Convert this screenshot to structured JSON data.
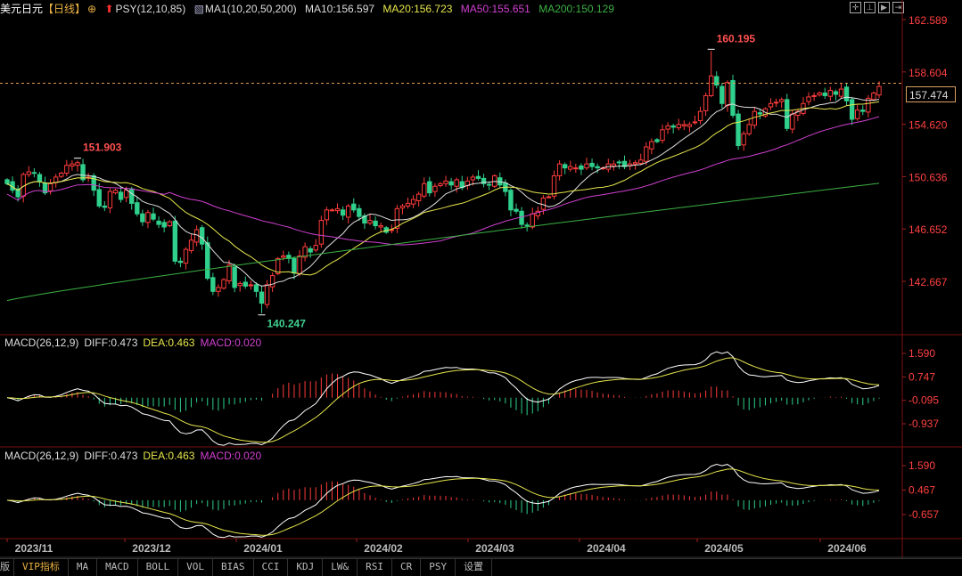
{
  "header": {
    "symbol": "美元日元",
    "period": "【日线】",
    "psy": "PSY(12,10,85)",
    "ma_name": "MA1(10,20,50,200)",
    "ma10": "MA10:156.597",
    "ma20": "MA20:156.723",
    "ma50": "MA50:155.651",
    "ma200": "MA200:150.129"
  },
  "toolbar": {
    "icons": [
      "crosshair-icon",
      "zoom-in-icon",
      "play-icon",
      "move-right-icon"
    ]
  },
  "colors": {
    "up": "#ff3b3b",
    "down": "#2fd08c",
    "ma10": "#e0e0e0",
    "ma20": "#e6e64c",
    "ma50": "#d040d0",
    "ma200": "#3cb043",
    "diff": "#ffffff",
    "dea": "#e6e64c",
    "macd": "#d040d0",
    "axis": "#ff4040"
  },
  "current_price": "157.474",
  "macd_panels": [
    {
      "title": "MACD(26,12,9)",
      "diff": "DIFF:0.473",
      "dea": "DEA:0.463",
      "macd": "MACD:0.020",
      "ticks": [
        "1.590",
        "0.747",
        "-0.095",
        "-0.937"
      ]
    },
    {
      "title": "MACD(26,12,9)",
      "diff": "DIFF:0.473",
      "dea": "DEA:0.463",
      "macd": "MACD:0.020",
      "ticks": [
        "1.590",
        "0.467",
        "-0.657"
      ]
    }
  ],
  "tabs": [
    "版",
    "VIP指标",
    "MA",
    "MACD",
    "BOLL",
    "VOL",
    "BIAS",
    "CCI",
    "KDJ",
    "LW&",
    "RSI",
    "CR",
    "PSY",
    "设置"
  ],
  "chart_data": {
    "type": "candlestick",
    "y_ticks": [
      "162.589",
      "158.604",
      "154.620",
      "150.636",
      "146.652",
      "142.667"
    ],
    "ylim": [
      140.0,
      163.0
    ],
    "x_ticks": [
      "2023/11",
      "2023/12",
      "2024/01",
      "2024/02",
      "2024/03",
      "2024/04",
      "2024/05",
      "2024/06"
    ],
    "annotations": {
      "high": "160.195",
      "low": "140.247",
      "nov_high": "151.903"
    },
    "ma200_range": [
      141.2,
      150.129
    ],
    "closes": [
      150.1,
      149.6,
      149.1,
      150.8,
      151.0,
      150.9,
      150.3,
      149.4,
      150.1,
      150.6,
      150.9,
      151.5,
      151.6,
      151.7,
      150.4,
      150.6,
      149.6,
      148.4,
      148.3,
      149.5,
      149.6,
      148.9,
      149.6,
      148.6,
      147.8,
      147.2,
      147.9,
      147.4,
      147.0,
      146.8,
      147.2,
      144.2,
      144.1,
      145.1,
      145.8,
      146.6,
      145.5,
      142.9,
      141.9,
      142.2,
      142.8,
      143.9,
      142.2,
      142.5,
      142.3,
      142.4,
      141.9,
      141.0,
      142.4,
      143.1,
      144.4,
      144.6,
      144.4,
      143.3,
      144.6,
      145.3,
      144.9,
      145.4,
      147.3,
      148.1,
      148.1,
      148.2,
      147.7,
      148.4,
      148.1,
      147.6,
      147.1,
      147.3,
      146.9,
      146.9,
      146.4,
      146.6,
      148.2,
      148.4,
      148.6,
      148.9,
      149.3,
      150.1,
      149.4,
      149.9,
      150.1,
      150.3,
      150.0,
      150.4,
      149.8,
      150.3,
      150.6,
      150.5,
      150.1,
      150.0,
      150.7,
      150.0,
      149.5,
      148.1,
      148.0,
      147.0,
      146.9,
      147.8,
      148.0,
      149.0,
      149.1,
      150.7,
      151.6,
      151.3,
      151.4,
      151.3,
      151.2,
      151.6,
      151.4,
      151.3,
      151.3,
      151.6,
      151.6,
      151.7,
      151.4,
      151.6,
      151.7,
      151.9,
      152.9,
      153.3,
      153.3,
      154.2,
      154.5,
      154.4,
      154.6,
      154.6,
      154.6,
      154.8,
      155.6,
      156.8,
      158.3,
      157.6,
      156.2,
      157.8,
      155.3,
      153.0,
      153.9,
      154.6,
      155.6,
      155.4,
      155.8,
      156.2,
      156.3,
      156.5,
      154.3,
      155.4,
      155.6,
      156.2,
      156.7,
      156.8,
      157.0,
      156.8,
      157.2,
      156.9,
      157.3,
      156.4,
      155.0,
      155.7,
      155.6,
      156.6,
      157.0,
      157.5
    ]
  }
}
